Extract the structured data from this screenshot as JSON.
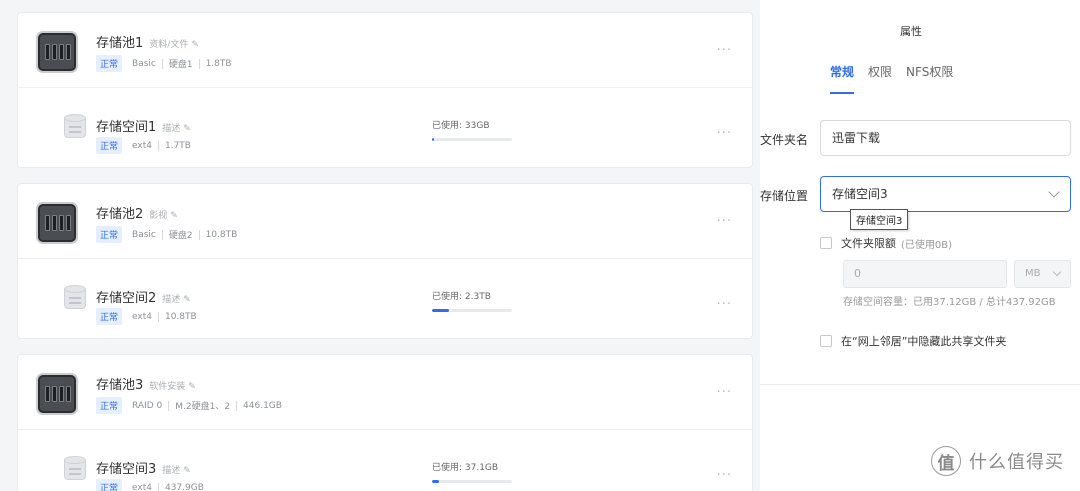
{
  "pools": [
    {
      "name": "存储池1",
      "desc": "资料/文件",
      "status": "正常",
      "type": "Basic",
      "disks": "硬盘1",
      "size": "1.8TB",
      "space": {
        "name": "存储空间1",
        "desc": "描述",
        "status": "正常",
        "fs": "ext4",
        "size": "1.7TB",
        "used_label": "已使用: 33GB",
        "used_ratio": 0.02
      }
    },
    {
      "name": "存储池2",
      "desc": "影视",
      "status": "正常",
      "type": "Basic",
      "disks": "硬盘2",
      "size": "10.8TB",
      "space": {
        "name": "存储空间2",
        "desc": "描述",
        "status": "正常",
        "fs": "ext4",
        "size": "10.8TB",
        "used_label": "已使用: 2.3TB",
        "used_ratio": 0.21
      }
    },
    {
      "name": "存储池3",
      "desc": "软件安装",
      "status": "正常",
      "type": "RAID 0",
      "disks": "M.2硬盘1、2",
      "size": "446.1GB",
      "space": {
        "name": "存储空间3",
        "desc": "描述",
        "status": "正常",
        "fs": "ext4",
        "size": "437.9GB",
        "used_label": "已使用: 37.1GB",
        "used_ratio": 0.085
      }
    }
  ],
  "panel": {
    "title": "属性",
    "tabs": [
      "常规",
      "权限",
      "NFS权限"
    ],
    "active_tab": 0,
    "folder_name_label": "文件夹名",
    "folder_name_value": "迅雷下载",
    "location_label": "存储位置",
    "location_value": "存储空间3",
    "tooltip": "存储空间3",
    "quota_label": "文件夹限额",
    "quota_note": "(已使用0B)",
    "quota_value": "0",
    "quota_unit": "MB",
    "capacity_text": "存储空间容量：已用37.12GB / 总计437.92GB",
    "hide_label": "在“网上邻居”中隐藏此共享文件夹"
  },
  "watermark": {
    "icon": "值",
    "text": "什么值得买"
  },
  "colors": {
    "accent": "#2f6ee8",
    "badge_bg": "#e6efff"
  }
}
